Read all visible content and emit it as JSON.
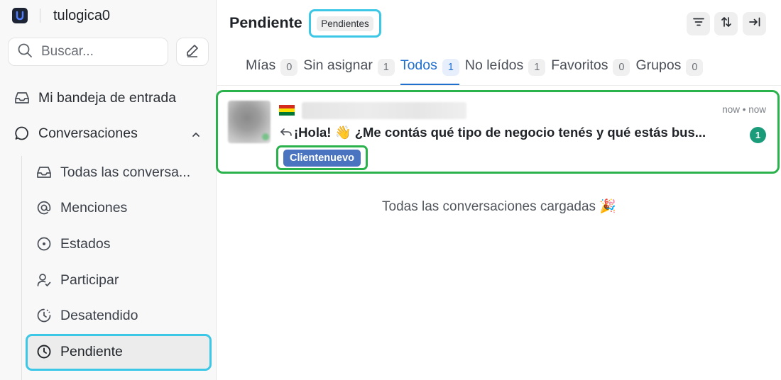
{
  "brand": {
    "name": "tulogica0",
    "logo_icon": "brand-logo-icon"
  },
  "search": {
    "placeholder": "Buscar..."
  },
  "nav": {
    "inbox_label": "Mi bandeja de entrada",
    "conversations_label": "Conversaciones",
    "sub_items": [
      {
        "label": "Todas las conversa...",
        "icon": "inbox-icon"
      },
      {
        "label": "Menciones",
        "icon": "at-icon"
      },
      {
        "label": "Estados",
        "icon": "status-icon"
      },
      {
        "label": "Participar",
        "icon": "person-check-icon"
      },
      {
        "label": "Desatendido",
        "icon": "clock-alert-icon"
      },
      {
        "label": "Pendiente",
        "icon": "clock-icon"
      }
    ]
  },
  "header": {
    "title": "Pendiente",
    "badge": "Pendientes"
  },
  "tabs": [
    {
      "label": "Mías",
      "count": "0",
      "active": false
    },
    {
      "label": "Sin asignar",
      "count": "1",
      "active": false
    },
    {
      "label": "Todos",
      "count": "1",
      "active": true
    },
    {
      "label": "No leídos",
      "count": "1",
      "active": false
    },
    {
      "label": "Favoritos",
      "count": "0",
      "active": false
    },
    {
      "label": "Grupos",
      "count": "0",
      "active": false
    }
  ],
  "conversation": {
    "times": "now • now",
    "preview": "¡Hola! 👋 ¿Me contás qué tipo de negocio tenés y qué estás bus...",
    "unread_count": "1",
    "label": "Clientenuevo",
    "flag_colors": [
      "#d52b1e",
      "#f9e300",
      "#007934"
    ]
  },
  "footer": {
    "loaded_text": "Todas las conversaciones cargadas 🎉"
  },
  "colors": {
    "accent": "#1f6fcf",
    "highlight_cyan": "#3cc7e6",
    "highlight_green": "#2bb24c",
    "label_blue": "#4a74bf",
    "unread_teal": "#1a9b7a"
  }
}
